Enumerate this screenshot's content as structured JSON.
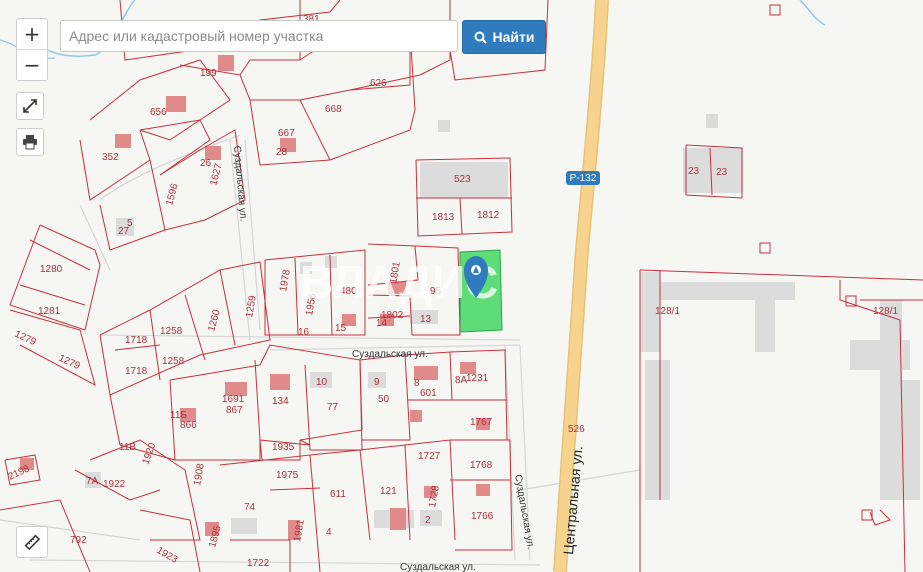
{
  "search": {
    "placeholder": "Адрес или кадастровый номер участка",
    "value": "",
    "button_label": "Найти"
  },
  "controls": {
    "zoom_in": "+",
    "zoom_out": "−"
  },
  "watermark": "ВЛАДИС",
  "road_badge": "Р-132",
  "streets": {
    "suzdalskaya": "Суздальская ул.",
    "tsentralnaya": "Центральная ул."
  },
  "parcel_labels": {
    "p381": "381",
    "p199": "199",
    "p626": "626",
    "p656": "656",
    "p668": "668",
    "p352": "352",
    "p667": "667",
    "p28": "28",
    "p26": "26",
    "p1596": "1596",
    "p1627": "1627",
    "p523": "523",
    "p1813": "1813",
    "p1812": "1812",
    "p23a": "23",
    "p23b": "23",
    "p5": "5",
    "p27": "27",
    "p1280": "1280",
    "p1281": "1281",
    "p1279a": "1279",
    "p1279b": "1279",
    "p1978": "1978",
    "p1956": "1956",
    "p480": "480",
    "p1801": "1801",
    "p95": "95",
    "p1802": "1802",
    "p14": "14",
    "p13": "13",
    "p16": "16",
    "p15": "15",
    "p1718a": "1718",
    "p1718b": "1718",
    "p1258a": "1258",
    "p1258b": "1258",
    "p1260": "1260",
    "p1259": "1259",
    "p1281b": "128/1",
    "p1281c": "128/1",
    "p10": "10",
    "p9": "9",
    "p8": "8",
    "p8a": "8А",
    "p1231": "1231",
    "p11b": "11Б",
    "p866": "866",
    "p867": "867",
    "p1691": "1691",
    "p134": "134",
    "p77": "77",
    "p50": "50",
    "p601": "601",
    "p1767": "1767",
    "p526": "526",
    "p11v": "11В",
    "p1920": "1920",
    "p1935": "1935",
    "p1727": "1727",
    "p1768": "1768",
    "p2198": "2198",
    "p7a": "7А",
    "p1922": "1922",
    "p1908": "1908",
    "p1975": "1975",
    "p611": "611",
    "p121": "121",
    "p1728": "1728",
    "p74": "74",
    "p2": "2",
    "p1766": "1766",
    "p792": "792",
    "p1895": "1895",
    "p1981": "1981",
    "p4": "4",
    "p1923": "1923",
    "p1722": "1722"
  }
}
